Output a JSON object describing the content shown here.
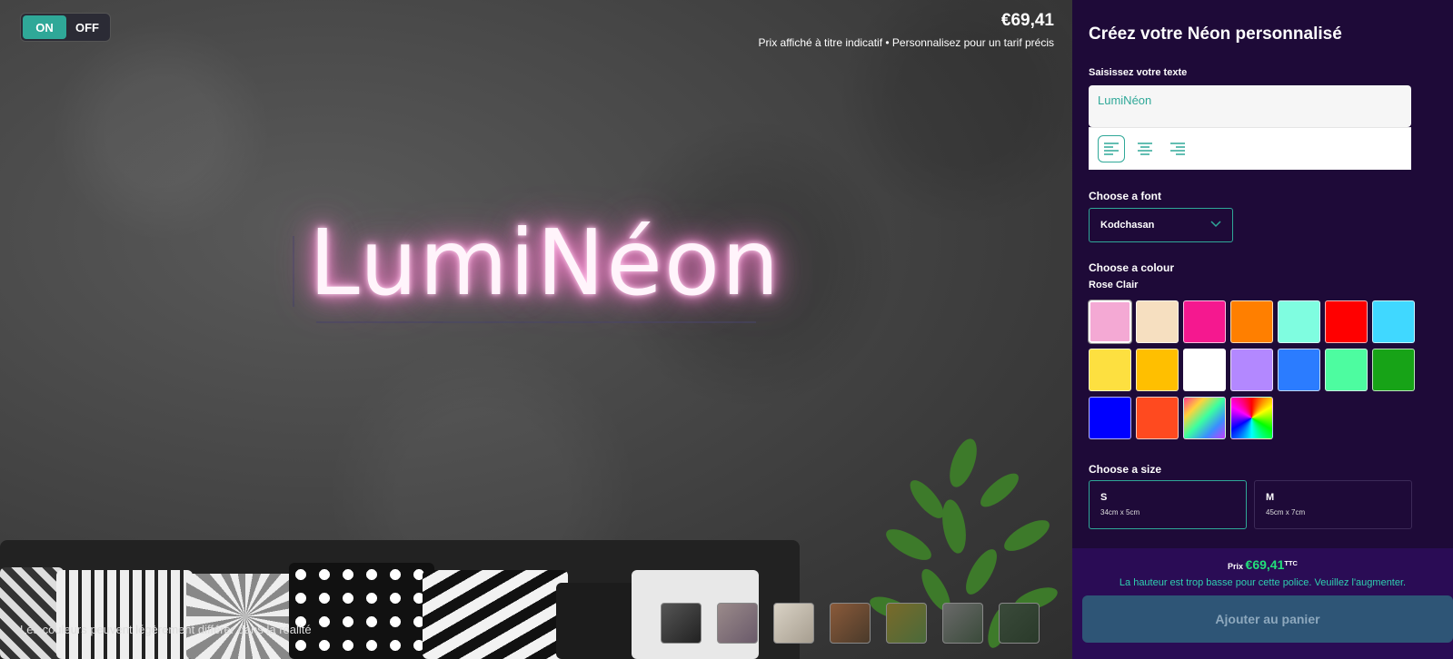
{
  "toggle": {
    "on_label": "ON",
    "off_label": "OFF"
  },
  "preview": {
    "price": "€69,41",
    "price_note": "Prix affiché à titre indicatif • Personnalisez pour un tarif précis",
    "neon_text": "LumiNéon",
    "disclaimer": "Les couleurs peuvent légèrement différer dans la réalité",
    "thumbnails": [
      "scene-1",
      "scene-2",
      "scene-3",
      "scene-4",
      "scene-5",
      "scene-6",
      "scene-7"
    ]
  },
  "panel": {
    "title": "Créez votre Néon personnalisé",
    "text_label": "Saisissez votre texte",
    "text_value": "LumiNéon",
    "font_label": "Choose a font",
    "font_value": "Kodchasan",
    "colour_label": "Choose a colour",
    "colour_selected": "Rose Clair",
    "colours": [
      "#f4a9d4",
      "#f6dfc0",
      "#f5188f",
      "#ff7f00",
      "#7ffde0",
      "#ff0000",
      "#40d8ff",
      "#fde040",
      "#ffbf00",
      "#ffffff",
      "#b388ff",
      "#2b7cff",
      "#4dfca0",
      "#17a317",
      "#0000ff",
      "#ff4a1f",
      "rainbow",
      "rainbow-conic"
    ],
    "size_label": "Choose a size",
    "sizes": [
      {
        "name": "S",
        "dims": "34cm x 5cm"
      },
      {
        "name": "M",
        "dims": "45cm x 7cm"
      }
    ],
    "price_prefix": "Prix",
    "price_value": "€69,41",
    "price_suffix": "TTC",
    "warning": "La hauteur est trop basse pour cette police. Veuillez l'augmenter.",
    "cart_label": "Ajouter au panier"
  }
}
